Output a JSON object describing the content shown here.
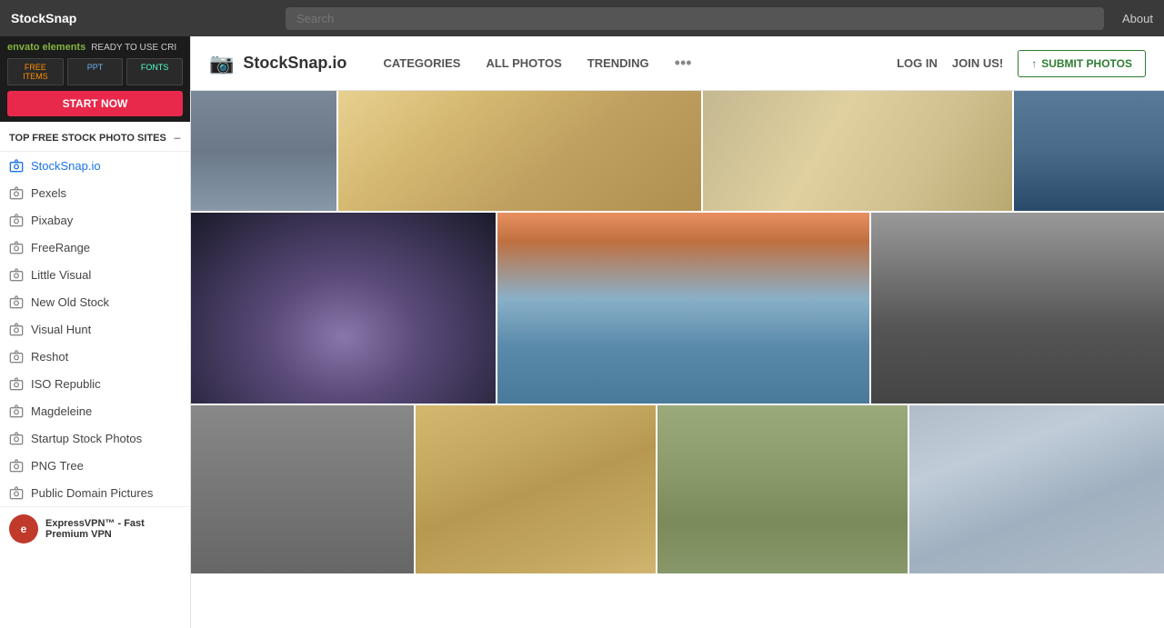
{
  "browser": {
    "title": "StockSnap",
    "search_placeholder": "Search",
    "about_label": "About"
  },
  "sidebar": {
    "envato": {
      "logo": "envato elements",
      "ready_label": "READY TO USE CRI",
      "item1": "FREE ITEMS",
      "item2": "PPT",
      "item3": "FONTS",
      "start_now": "START NOW"
    },
    "section_title": "TOP FREE STOCK PHOTO SITES",
    "items": [
      {
        "label": "StockSnap.io",
        "active": true
      },
      {
        "label": "Pexels",
        "active": false
      },
      {
        "label": "Pixabay",
        "active": false
      },
      {
        "label": "FreeRange",
        "active": false
      },
      {
        "label": "Little Visual",
        "active": false
      },
      {
        "label": "New Old Stock",
        "active": false
      },
      {
        "label": "Visual Hunt",
        "active": false
      },
      {
        "label": "Reshot",
        "active": false
      },
      {
        "label": "ISO Republic",
        "active": false
      },
      {
        "label": "Magdeleine",
        "active": false
      },
      {
        "label": "Startup Stock Photos",
        "active": false
      },
      {
        "label": "PNG Tree",
        "active": false
      },
      {
        "label": "Public Domain Pictures",
        "active": false
      }
    ],
    "ad": {
      "icon_letter": "e",
      "text": "ExpressVPN™ - Fast Premium VPN"
    }
  },
  "stocksnap": {
    "logo_text": "StockSnap.io",
    "nav": {
      "categories": "CATEGORIES",
      "all_photos": "ALL PHOTOS",
      "trending": "TRENDING",
      "dots": "•••",
      "login": "LOG IN",
      "join": "JOIN US!",
      "submit": "SUBMIT PHOTOS",
      "submit_icon": "↑"
    }
  }
}
